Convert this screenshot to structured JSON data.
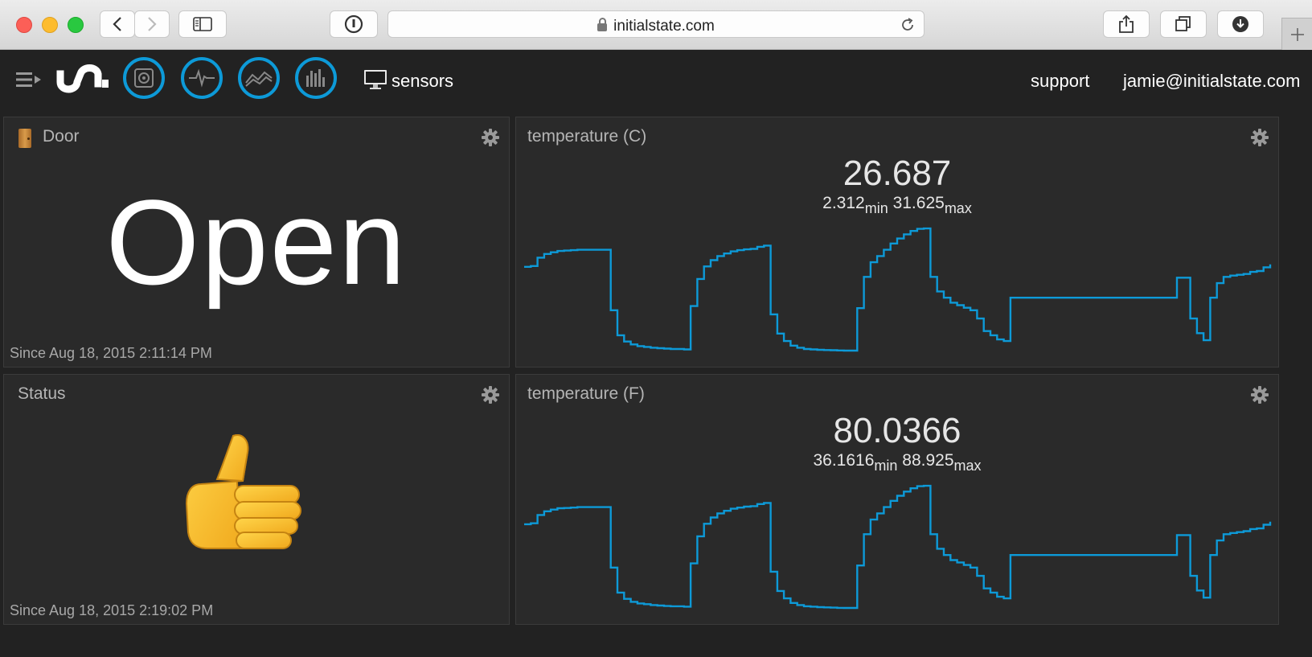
{
  "browser": {
    "url": "initialstate.com"
  },
  "header": {
    "bucket_name": "sensors",
    "support": "support",
    "user_email": "jamie@initialstate.com",
    "nav_icons": [
      "signal-icon",
      "waveform-icon",
      "line-chart-icon",
      "bar-chart-icon"
    ]
  },
  "tiles": {
    "door": {
      "title": "Door",
      "value": "Open",
      "since": "Since Aug 18, 2015 2:11:14 PM"
    },
    "status": {
      "title": "Status",
      "value": "👍",
      "since": "Since Aug 18, 2015 2:19:02 PM"
    },
    "temp_c": {
      "title": "temperature (C)",
      "current": "26.687",
      "min": "2.312",
      "max": "31.625",
      "min_label": "min",
      "max_label": "max"
    },
    "temp_f": {
      "title": "temperature (F)",
      "current": "80.0366",
      "min": "36.1616",
      "max": "88.925",
      "min_label": "min",
      "max_label": "max"
    }
  },
  "colors": {
    "accent": "#0d9ad8",
    "background": "#222222",
    "tile": "#2a2a2a"
  },
  "chart_data": [
    {
      "type": "line",
      "series": [
        {
          "values": [
            22.4,
            22.6,
            24.6,
            25.5,
            25.9,
            26.2,
            26.3,
            26.4,
            26.5,
            26.5,
            26.5,
            26.5,
            26.5,
            12.0,
            6.0,
            4.5,
            3.8,
            3.4,
            3.2,
            3.0,
            2.9,
            2.8,
            2.7,
            2.7,
            2.6,
            13.0,
            19.5,
            22.5,
            24.0,
            25.0,
            25.6,
            26.1,
            26.4,
            26.6,
            26.7,
            27.2,
            27.5,
            11.0,
            6.4,
            4.6,
            3.5,
            3.0,
            2.7,
            2.6,
            2.5,
            2.45,
            2.4,
            2.35,
            2.32,
            2.31,
            12.5,
            20.0,
            23.5,
            25.0,
            26.5,
            28.0,
            29.2,
            30.2,
            31.0,
            31.5,
            31.6,
            20.0,
            16.5,
            15.0,
            13.8,
            13.2,
            12.6,
            12.0,
            10.0,
            7.0,
            6.0,
            5.0,
            4.6,
            15.0,
            15.0,
            15.0,
            15.0,
            15.0,
            15.0,
            15.0,
            15.0,
            15.0,
            15.0,
            15.0,
            15.0,
            15.0,
            15.0,
            15.0,
            15.0,
            15.0,
            15.0,
            15.0,
            15.0,
            15.0,
            15.0,
            15.0,
            15.0,
            15.0,
            19.8,
            19.8,
            10.0,
            6.5,
            4.8,
            15.0,
            18.5,
            20.0,
            20.3,
            20.5,
            20.7,
            21.2,
            21.4,
            22.3,
            23.0
          ]
        }
      ],
      "ylim": [
        2.312,
        31.625
      ]
    },
    {
      "type": "line",
      "series": [
        {
          "values": [
            72.3,
            72.7,
            76.3,
            77.9,
            78.6,
            79.2,
            79.3,
            79.5,
            79.7,
            79.7,
            79.7,
            79.7,
            79.7,
            53.6,
            42.8,
            40.1,
            38.8,
            38.1,
            37.8,
            37.4,
            37.2,
            37.0,
            36.9,
            36.9,
            36.7,
            55.4,
            67.1,
            72.5,
            75.2,
            77.0,
            78.1,
            79.0,
            79.5,
            79.9,
            80.1,
            81.0,
            81.5,
            51.8,
            43.5,
            40.3,
            38.3,
            37.4,
            36.9,
            36.7,
            36.5,
            36.4,
            36.3,
            36.2,
            36.17,
            36.16,
            54.5,
            68.0,
            74.3,
            77.0,
            79.7,
            82.4,
            84.6,
            86.4,
            87.8,
            88.7,
            88.9,
            68.0,
            61.7,
            59.0,
            56.8,
            55.8,
            54.7,
            53.6,
            50.0,
            44.6,
            42.8,
            41.0,
            40.3,
            59.0,
            59.0,
            59.0,
            59.0,
            59.0,
            59.0,
            59.0,
            59.0,
            59.0,
            59.0,
            59.0,
            59.0,
            59.0,
            59.0,
            59.0,
            59.0,
            59.0,
            59.0,
            59.0,
            59.0,
            59.0,
            59.0,
            59.0,
            59.0,
            59.0,
            67.6,
            67.6,
            50.0,
            43.7,
            40.6,
            59.0,
            65.3,
            68.0,
            68.5,
            68.9,
            69.3,
            70.2,
            70.5,
            72.1,
            73.4
          ]
        }
      ],
      "ylim": [
        36.1616,
        88.925
      ]
    }
  ]
}
